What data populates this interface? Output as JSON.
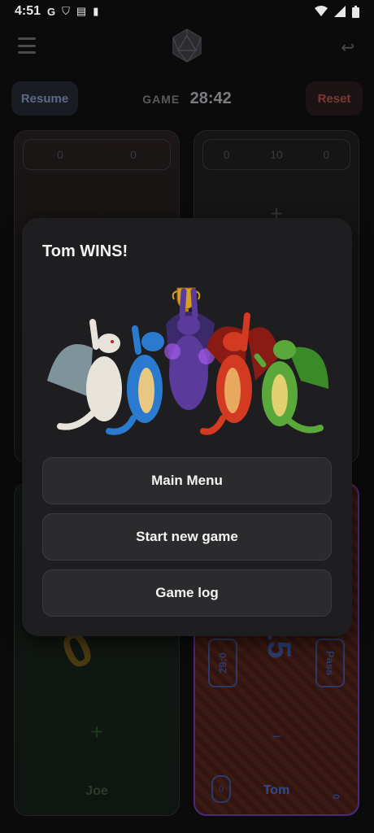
{
  "status_bar": {
    "time": "4:51",
    "left_icons": [
      "google-icon",
      "shield-icon",
      "news-icon",
      "sd-card-icon"
    ],
    "right_icons": [
      "wifi-icon",
      "signal-icon",
      "battery-icon"
    ]
  },
  "header": {
    "menu_icon": "hamburger-icon",
    "logo_icon": "d20-icon",
    "undo_icon": "undo-icon"
  },
  "controls": {
    "resume_label": "Resume",
    "reset_label": "Reset",
    "timer_label": "GAME",
    "timer_value": "28:42"
  },
  "players": [
    {
      "counters": [
        "0",
        "0"
      ],
      "name": ""
    },
    {
      "counters": [
        "0",
        "10",
        "0"
      ],
      "name": ""
    },
    {
      "name": "Joe",
      "life": "0"
    },
    {
      "name": "Tom",
      "life": "15",
      "left_side": "29:0",
      "right_side": "Pass",
      "corner_left": "0",
      "corner_right": "0"
    }
  ],
  "modal": {
    "title": "Tom WINS!",
    "image_description_icon": "dragons-trophy-illustration",
    "buttons": {
      "main_menu": "Main Menu",
      "new_game": "Start new game",
      "game_log": "Game log"
    }
  },
  "colors": {
    "modal_bg": "#1e1e20",
    "button_bg": "#2b2b2e",
    "dragon_white": "#e8e4dc",
    "dragon_blue": "#2a7ad0",
    "dragon_purple": "#5a3a9a",
    "dragon_red": "#d23a22",
    "dragon_green": "#5aa83a",
    "trophy_gold": "#d8a020"
  }
}
